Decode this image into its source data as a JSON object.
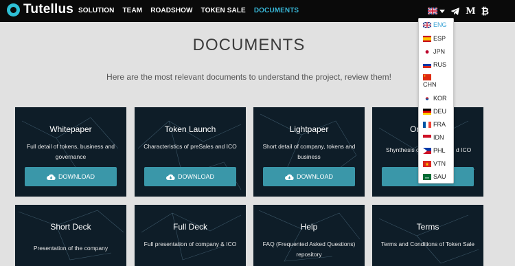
{
  "brand": {
    "name": "Tutellus"
  },
  "nav": {
    "items": [
      "SOLUTION",
      "TEAM",
      "ROADSHOW",
      "TOKEN SALE",
      "DOCUMENTS"
    ],
    "active_index": 4,
    "social": {
      "medium": "M",
      "bitcoin": "₿"
    }
  },
  "page": {
    "title": "DOCUMENTS",
    "intro": "Here are the most relevant documents to understand the project, review them!"
  },
  "cards": [
    {
      "title": "Whitepaper",
      "desc": "Full detail of tokens, business and governance",
      "button": "DOWNLOAD"
    },
    {
      "title": "Token Launch",
      "desc": "Characteristics of preSales and ICO",
      "button": "DOWNLOAD"
    },
    {
      "title": "Lightpaper",
      "desc": "Short detail of company, tokens and business",
      "button": "DOWNLOAD"
    },
    {
      "title": "On",
      "desc": "Shynthesis o",
      "desc_tail": "d ICO",
      "button": "DOWNLOAD",
      "button_visible": "D"
    },
    {
      "title": "Short Deck",
      "desc": "Presentation of the company"
    },
    {
      "title": "Full Deck",
      "desc": "Full presentation of company & ICO"
    },
    {
      "title": "Help",
      "desc": "FAQ (Frequented Asked Questions) repository"
    },
    {
      "title": "Terms",
      "desc": "Terms and Conditions of Token Sale"
    }
  ],
  "languages": [
    {
      "code": "ENG",
      "active": true
    },
    {
      "code": "ESP"
    },
    {
      "code": "JPN"
    },
    {
      "code": "RUS"
    },
    {
      "code": "CHN"
    },
    {
      "code": "KOR"
    },
    {
      "code": "DEU"
    },
    {
      "code": "FRA"
    },
    {
      "code": "IDN"
    },
    {
      "code": "PHL"
    },
    {
      "code": "VTN"
    },
    {
      "code": "SAU"
    }
  ],
  "colors": {
    "accent": "#38b6d6",
    "button": "#3a97a9",
    "card": "#0d1b26",
    "nav": "#0a0a0a"
  }
}
